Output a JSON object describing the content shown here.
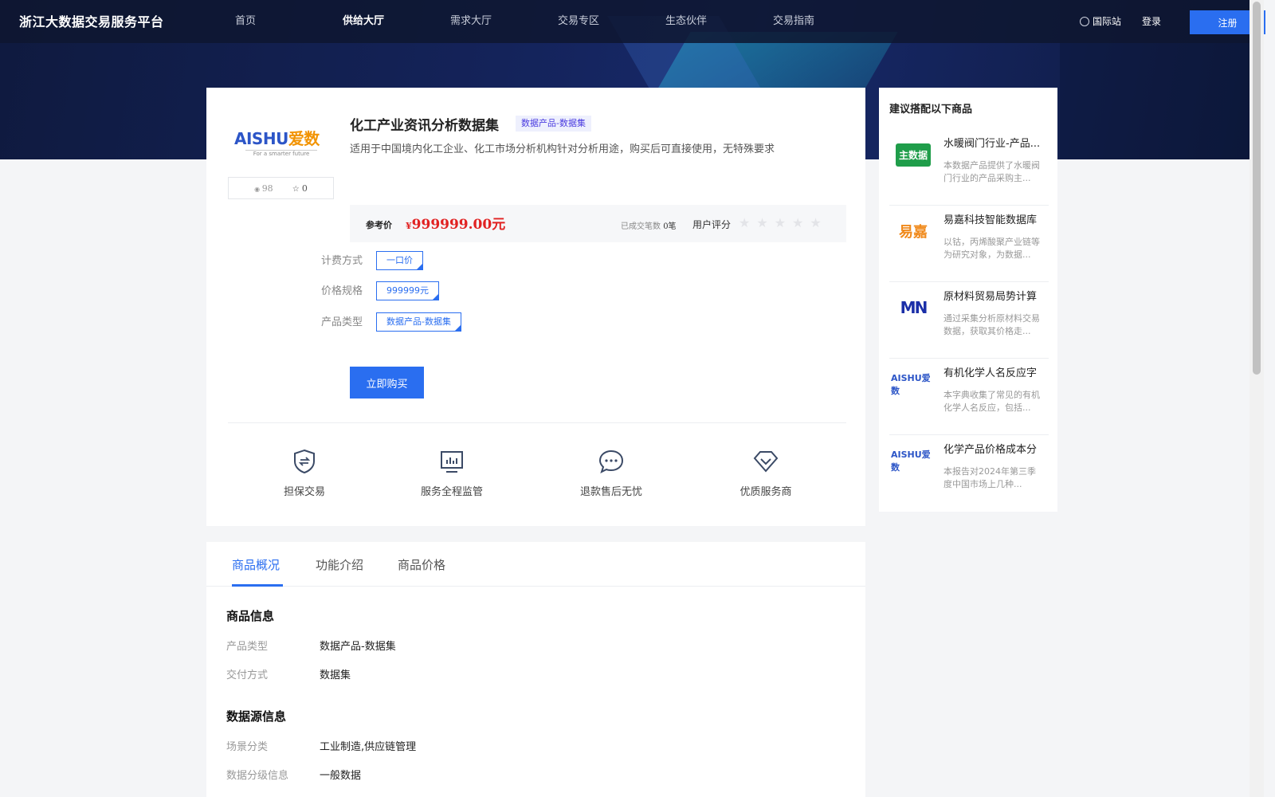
{
  "header": {
    "logo": "浙江大数据交易服务平台",
    "nav": [
      "首页",
      "供给大厅",
      "需求大厅",
      "交易专区",
      "生态伙伴",
      "交易指南"
    ],
    "intl": "国际站",
    "login": "登录",
    "register": "注册"
  },
  "product": {
    "logo_main": "AISHU",
    "logo_cn": "爱数",
    "logo_slogan": "For a smarter future",
    "views": "98",
    "stars": "0",
    "title": "化工产业资讯分析数据集",
    "category_tag": "数据产品-数据集",
    "description": "适用于中国境内化工企业、化工市场分析机构针对分析用途，购买后可直接使用，无特殊要求",
    "price_label": "参考价",
    "price_currency": "¥",
    "price": "999999.00元",
    "deal_label": "已成交笔数",
    "deal_count": "0笔",
    "rating_label": "用户评分",
    "rating_stars": "★★★★★",
    "options": [
      {
        "label": "计费方式",
        "value": "一口价"
      },
      {
        "label": "价格规格",
        "value": "999999元"
      },
      {
        "label": "产品类型",
        "value": "数据产品-数据集"
      }
    ],
    "buy": "立即购买",
    "guarantees": [
      "担保交易",
      "服务全程监管",
      "退款售后无忧",
      "优质服务商"
    ]
  },
  "sidebar": {
    "title": "建议搭配以下商品",
    "items": [
      {
        "name": "水暖阀门行业-产品...",
        "desc": "本数据产品提供了水暖阀门行业的产品采购主...",
        "thumb": "主数据"
      },
      {
        "name": "易嘉科技智能数据库",
        "desc": "以钴，丙烯酸聚产业链等为研究对象，为数据...",
        "thumb": "易嘉"
      },
      {
        "name": "原材料贸易局势计算",
        "desc": "通过采集分析原材料交易数据，获取其价格走...",
        "thumb": "MN"
      },
      {
        "name": "有机化学人名反应字",
        "desc": "本字典收集了常见的有机化学人名反应，包括...",
        "thumb": "AISHU爱数"
      },
      {
        "name": "化学产品价格成本分",
        "desc": "本报告对2024年第三季度中国市场上几种...",
        "thumb": "AISHU爱数"
      }
    ]
  },
  "tabs": {
    "items": [
      "商品概况",
      "功能介绍",
      "商品价格"
    ]
  },
  "overview": {
    "section1_title": "商品信息",
    "section1": [
      {
        "k": "产品类型",
        "v": "数据产品-数据集"
      },
      {
        "k": "交付方式",
        "v": "数据集"
      }
    ],
    "section2_title": "数据源信息",
    "section2": [
      {
        "k": "场景分类",
        "v": "工业制造,供应链管理"
      },
      {
        "k": "数据分级信息",
        "v": "一般数据"
      }
    ]
  },
  "colors": {
    "accent": "#2a6ef0",
    "price": "#e12222",
    "header": "#0e1630"
  }
}
